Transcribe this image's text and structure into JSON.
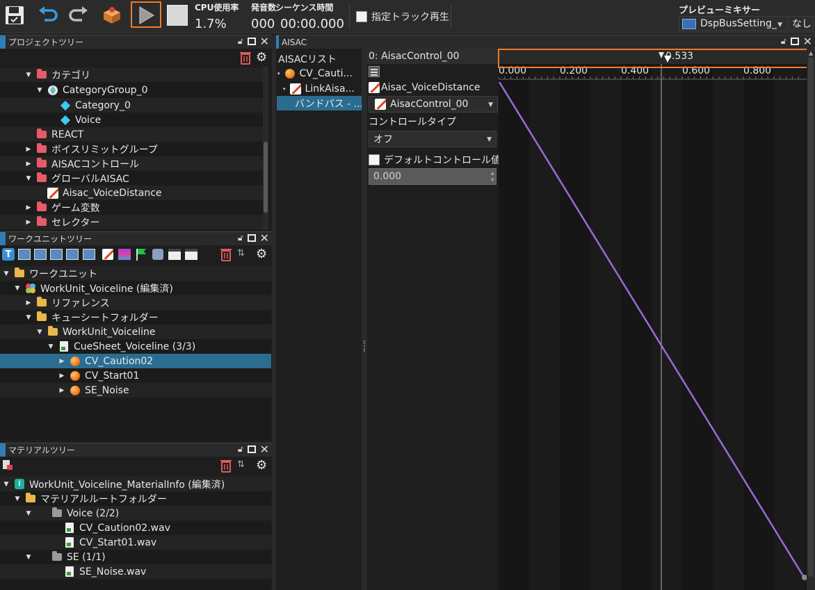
{
  "toolbar": {
    "cpu_label": "CPU使用率",
    "cpu_value": "1.7%",
    "sound_label": "発音数",
    "seq_label": "シーケンス時間",
    "sound_value": "000",
    "seq_value": "00:00.000",
    "solo_track_label": "指定トラック再生",
    "preview_mixer_label": "プレビューミキサー",
    "dsp_bus_value": "DspBusSetting_",
    "none_value": "なし"
  },
  "project_tree": {
    "title": "プロジェクトツリー",
    "items": [
      {
        "label": "カテゴリ",
        "icon": "red-folder-icon"
      },
      {
        "label": "CategoryGroup_0",
        "icon": "category-group-icon"
      },
      {
        "label": "Category_0",
        "icon": "diamond-icon"
      },
      {
        "label": "Voice",
        "icon": "diamond-icon"
      },
      {
        "label": "REACT",
        "icon": "red-folder-icon"
      },
      {
        "label": "ボイスリミットグループ",
        "icon": "red-folder-icon"
      },
      {
        "label": "AISACコントロール",
        "icon": "red-folder-icon"
      },
      {
        "label": "グローバルAISAC",
        "icon": "red-folder-icon"
      },
      {
        "label": "Aisac_VoiceDistance",
        "icon": "aisac-icon"
      },
      {
        "label": "ゲーム変数",
        "icon": "red-folder-icon"
      },
      {
        "label": "セレクター",
        "icon": "red-folder-icon"
      }
    ]
  },
  "workunit_tree": {
    "title": "ワークユニットツリー",
    "items": [
      {
        "label": "ワークユニット",
        "icon": "yellow-folder-icon"
      },
      {
        "label": "WorkUnit_Voiceline (編集済)",
        "icon": "workunit-icon"
      },
      {
        "label": "リファレンス",
        "icon": "yellow-folder-icon"
      },
      {
        "label": "キューシートフォルダー",
        "icon": "yellow-folder-icon"
      },
      {
        "label": "WorkUnit_Voiceline",
        "icon": "yellow-folder-icon"
      },
      {
        "label": "CueSheet_Voiceline (3/3)",
        "icon": "cuesheet-icon"
      },
      {
        "label": "CV_Caution02",
        "icon": "cue-icon"
      },
      {
        "label": "CV_Start01",
        "icon": "cue-icon"
      },
      {
        "label": "SE_Noise",
        "icon": "cue-icon"
      }
    ]
  },
  "material_tree": {
    "title": "マテリアルツリー",
    "items": [
      {
        "label": "WorkUnit_Voiceline_MaterialInfo (編集済)",
        "icon": "material-info-icon"
      },
      {
        "label": "マテリアルルートフォルダー",
        "icon": "yellow-folder-icon"
      },
      {
        "label": "Voice (2/2)",
        "icon": "gray-folder-icon"
      },
      {
        "label": "CV_Caution02.wav",
        "icon": "wav-file-icon"
      },
      {
        "label": "CV_Start01.wav",
        "icon": "wav-file-icon"
      },
      {
        "label": "SE (1/1)",
        "icon": "gray-folder-icon"
      },
      {
        "label": "SE_Noise.wav",
        "icon": "wav-file-icon"
      }
    ]
  },
  "aisac_panel": {
    "title": "AISAC",
    "list_header": "AISACリスト",
    "list_items": [
      "CV_Cauti...",
      "LinkAisa...",
      "バンドパス - ..."
    ],
    "control_header": "0: AisacControl_00",
    "aisac_name": "Aisac_VoiceDistance",
    "control_dropdown": "AisacControl_00",
    "control_type_label": "コントロールタイプ",
    "control_type_value": "オフ",
    "default_control_label": "デフォルトコントロール値",
    "default_value": "0.000",
    "cursor_value": "0.533",
    "ticks": [
      "0.000",
      "0.200",
      "0.400",
      "0.600",
      "0.800"
    ]
  },
  "colors": {
    "accent": "#2f7fb5",
    "selection": "#2a6d91",
    "highlight": "#f07b2a",
    "curve": "#9a6bd6"
  }
}
